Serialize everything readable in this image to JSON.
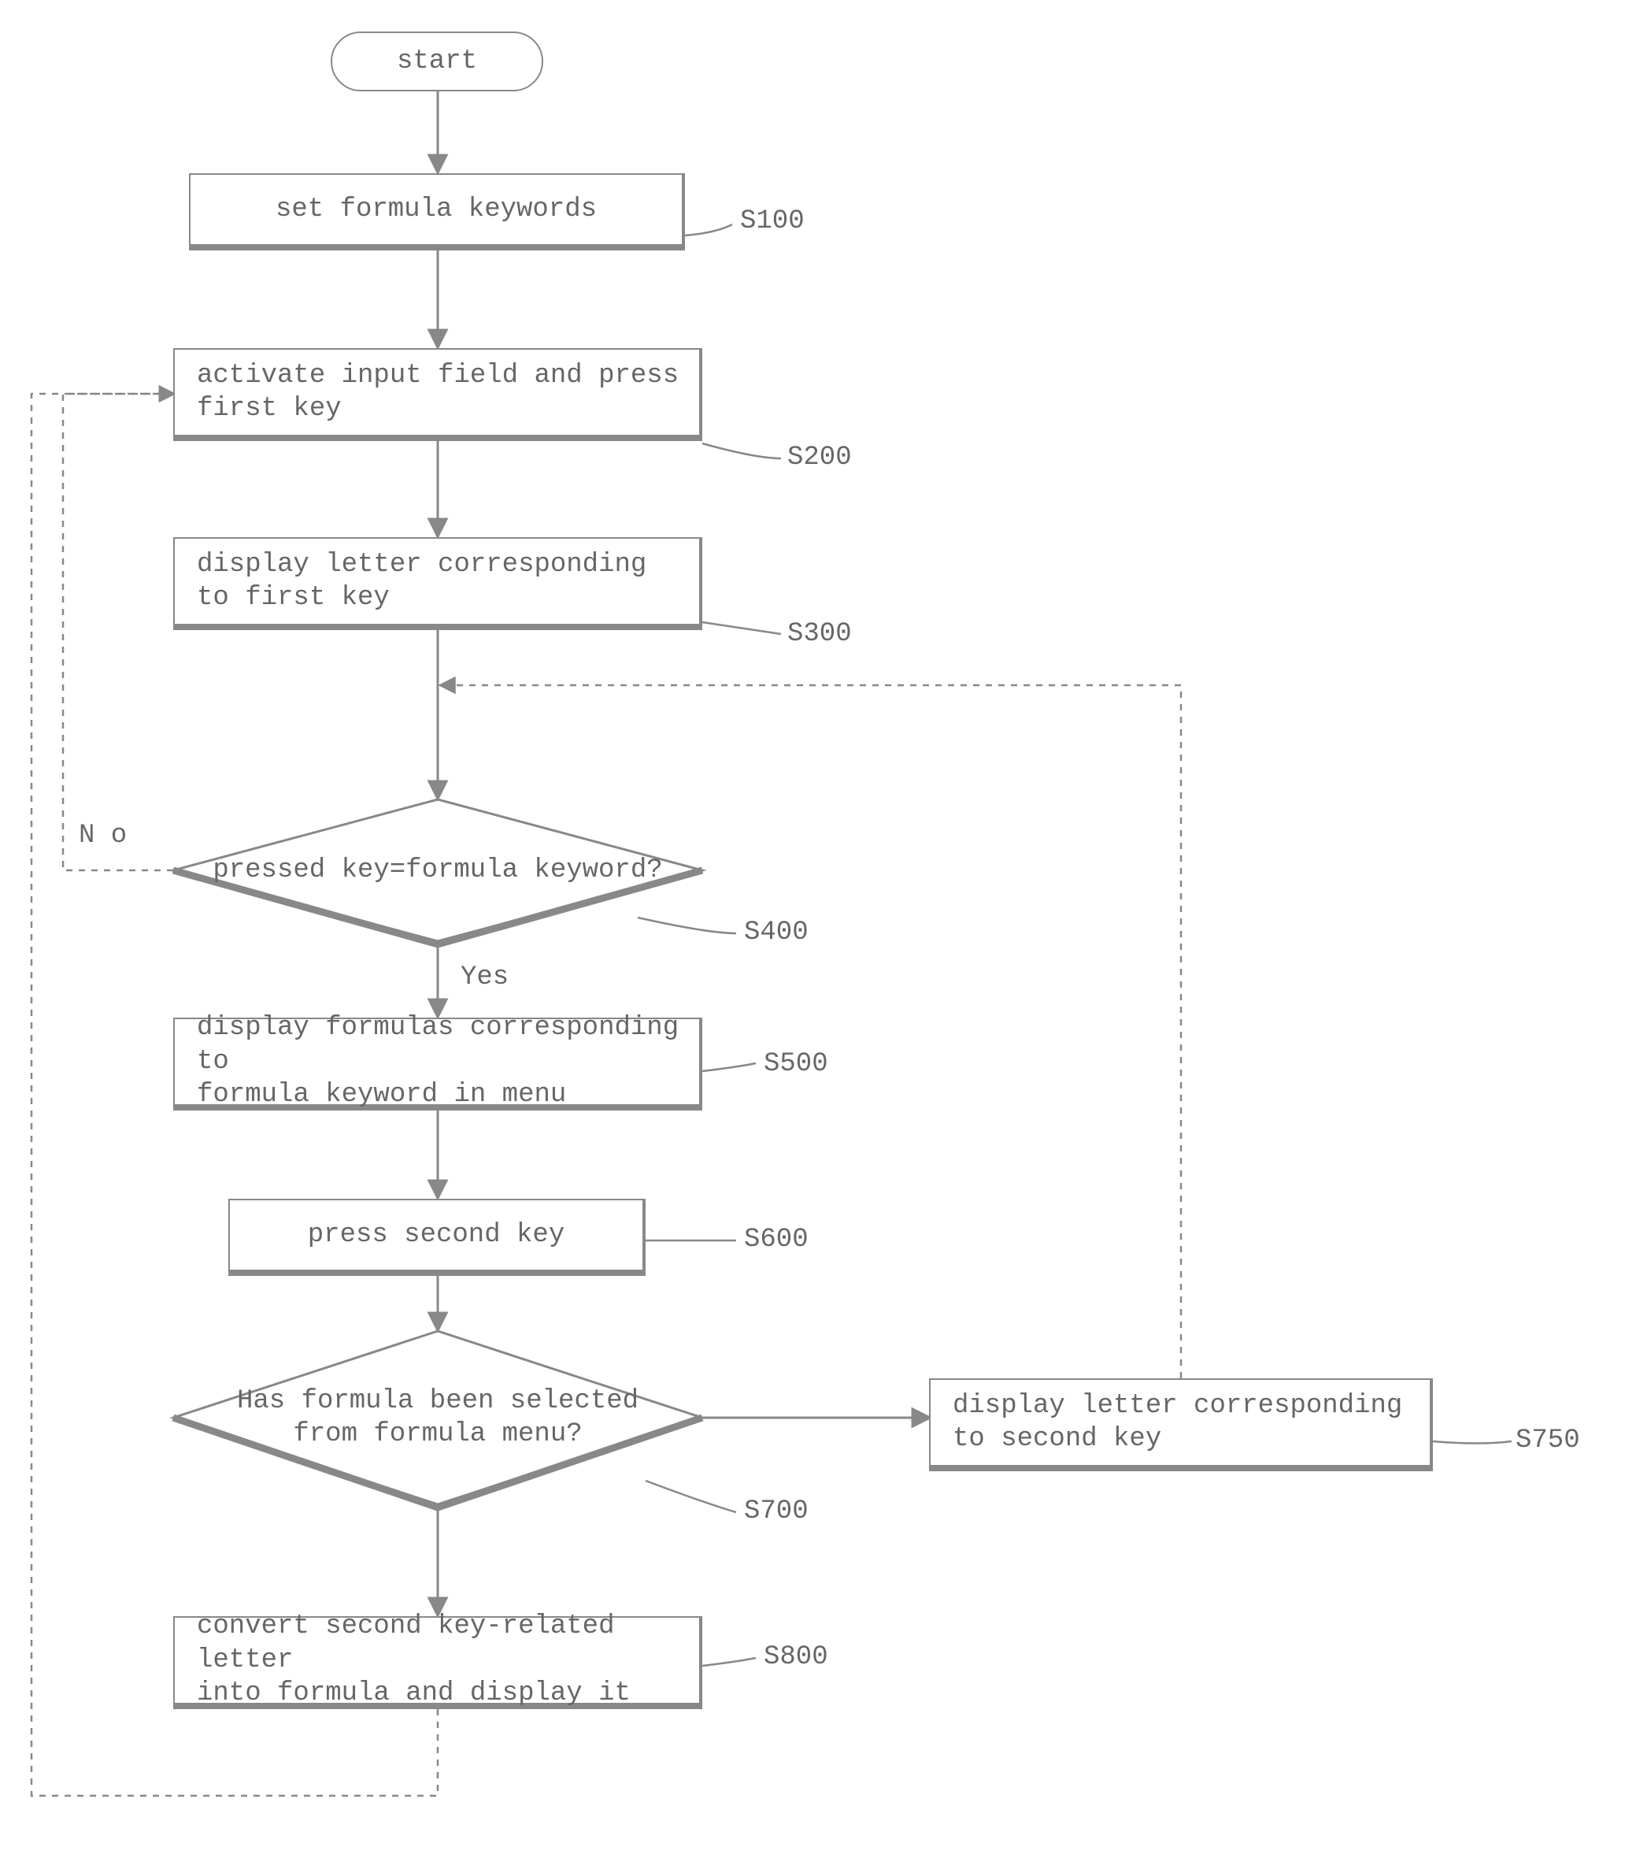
{
  "terminator": {
    "label": "start"
  },
  "steps": {
    "s100": {
      "code": "S100",
      "text": "set formula keywords"
    },
    "s200": {
      "code": "S200",
      "text1": "activate input field and press",
      "text2": "first key"
    },
    "s300": {
      "code": "S300",
      "text1": "display letter corresponding",
      "text2": "to first key"
    },
    "s400": {
      "code": "S400",
      "text": "pressed key=formula keyword?"
    },
    "s500": {
      "code": "S500",
      "text1": "display formulas corresponding to",
      "text2": "formula keyword in menu"
    },
    "s600": {
      "code": "S600",
      "text": "press second key"
    },
    "s700": {
      "code": "S700",
      "text1": "Has formula been selected",
      "text2": "from formula menu?"
    },
    "s750": {
      "code": "S750",
      "text1": "display letter corresponding",
      "text2": "to second key"
    },
    "s800": {
      "code": "S800",
      "text1": "convert second key-related letter",
      "text2": "into formula and display it"
    }
  },
  "branches": {
    "no": "N o",
    "yes": "Yes"
  }
}
